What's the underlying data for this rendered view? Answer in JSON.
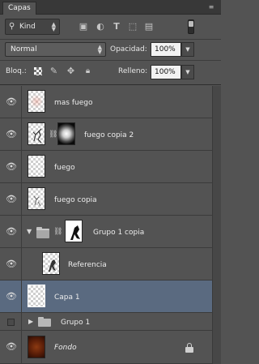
{
  "panel": {
    "tab_label": "Capas",
    "menu_icon": "hamburger-arrows"
  },
  "filter": {
    "kind_label": "Kind",
    "kind_icon": "search",
    "icons": [
      "image-filter",
      "adjustment-filter",
      "type-filter",
      "shape-filter",
      "smart-object-filter"
    ]
  },
  "blend": {
    "mode": "Normal",
    "opacity_label": "Opacidad:",
    "opacity_value": "100%"
  },
  "lock": {
    "label": "Bloq.:",
    "fill_label": "Relleno:",
    "fill_value": "100%"
  },
  "layers": [
    {
      "name": "mas fuego",
      "visible": true,
      "type": "pixel"
    },
    {
      "name": "fuego copia 2",
      "visible": true,
      "type": "pixel-masked"
    },
    {
      "name": "fuego",
      "visible": true,
      "type": "pixel"
    },
    {
      "name": "fuego copia",
      "visible": true,
      "type": "pixel"
    },
    {
      "name": "Grupo 1 copia",
      "visible": true,
      "type": "group-masked",
      "expanded": true
    },
    {
      "name": "Referencia",
      "visible": true,
      "type": "pixel"
    },
    {
      "name": "Capa 1",
      "visible": true,
      "type": "pixel",
      "selected": true
    },
    {
      "name": "Grupo 1",
      "visible": false,
      "type": "group",
      "expanded": false
    },
    {
      "name": "Fondo",
      "visible": true,
      "type": "background",
      "locked": true
    }
  ],
  "colors": {
    "panel_bg": "#535353",
    "selected_row": "#5a6a80",
    "fondo_thumb": "#8c3a12"
  }
}
